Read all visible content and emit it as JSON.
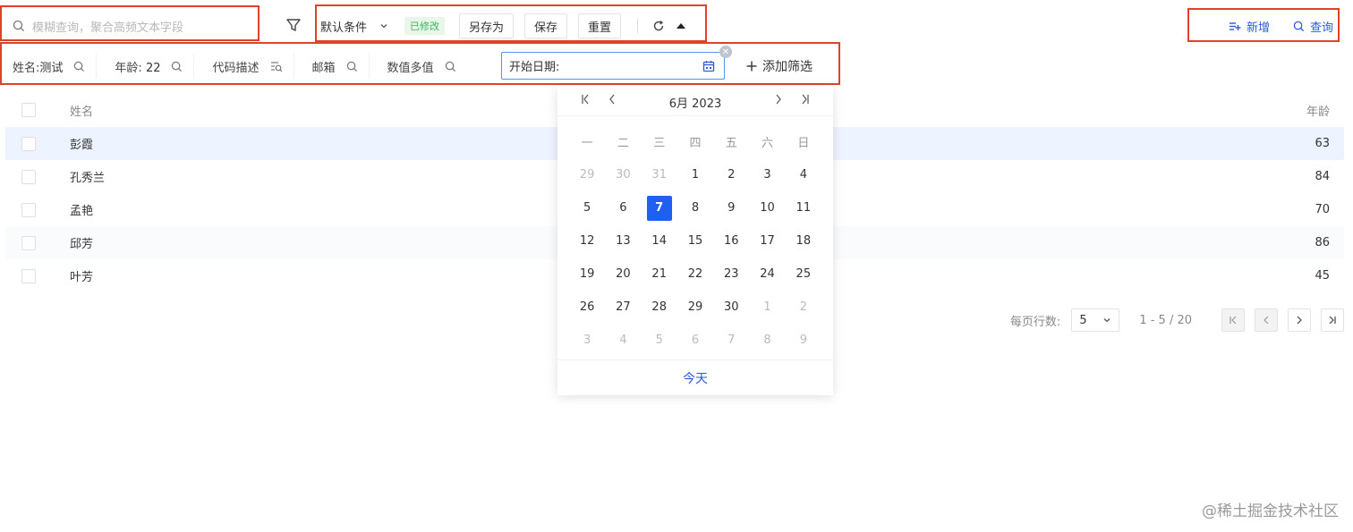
{
  "search": {
    "placeholder": "模糊查询，聚合高频文本字段"
  },
  "conditions": {
    "selected": "默认条件",
    "modified_badge": "已修改",
    "save_as": "另存为",
    "save": "保存",
    "reset": "重置"
  },
  "actions": {
    "add": "新增",
    "query": "查询"
  },
  "filters": [
    {
      "label": "姓名:",
      "value": "测试"
    },
    {
      "label": "年龄:",
      "value": "22"
    },
    {
      "label": "代码描述",
      "value": ""
    },
    {
      "label": "邮箱",
      "value": ""
    },
    {
      "label": "数值多值",
      "value": ""
    }
  ],
  "date_filter": {
    "label": "开始日期:"
  },
  "add_filter": "添加筛选",
  "table": {
    "headers": {
      "name": "姓名",
      "age": "年龄"
    },
    "rows": [
      {
        "name": "彭霞",
        "age": "63"
      },
      {
        "name": "孔秀兰",
        "age": "84"
      },
      {
        "name": "孟艳",
        "age": "70"
      },
      {
        "name": "邱芳",
        "age": "86"
      },
      {
        "name": "叶芳",
        "age": "45"
      }
    ]
  },
  "pagination": {
    "rows_per_page_label": "每页行数:",
    "page_size": "5",
    "range": "1 - 5 / 20"
  },
  "datepicker": {
    "title": "6月 2023",
    "weekdays": [
      "一",
      "二",
      "三",
      "四",
      "五",
      "六",
      "日"
    ],
    "weeks": [
      [
        "29",
        "30",
        "31",
        "1",
        "2",
        "3",
        "4"
      ],
      [
        "5",
        "6",
        "7",
        "8",
        "9",
        "10",
        "11"
      ],
      [
        "12",
        "13",
        "14",
        "15",
        "16",
        "17",
        "18"
      ],
      [
        "19",
        "20",
        "21",
        "22",
        "23",
        "24",
        "25"
      ],
      [
        "26",
        "27",
        "28",
        "29",
        "30",
        "1",
        "2"
      ],
      [
        "3",
        "4",
        "5",
        "6",
        "7",
        "8",
        "9"
      ]
    ],
    "selected": "7",
    "today": "今天"
  },
  "watermark": "@稀土掘金技术社区",
  "colors": {
    "accent": "#1f5ff2",
    "link": "#2b5bd7",
    "highlight_border": "#e0412b",
    "selected_row": "#edf3ff"
  }
}
